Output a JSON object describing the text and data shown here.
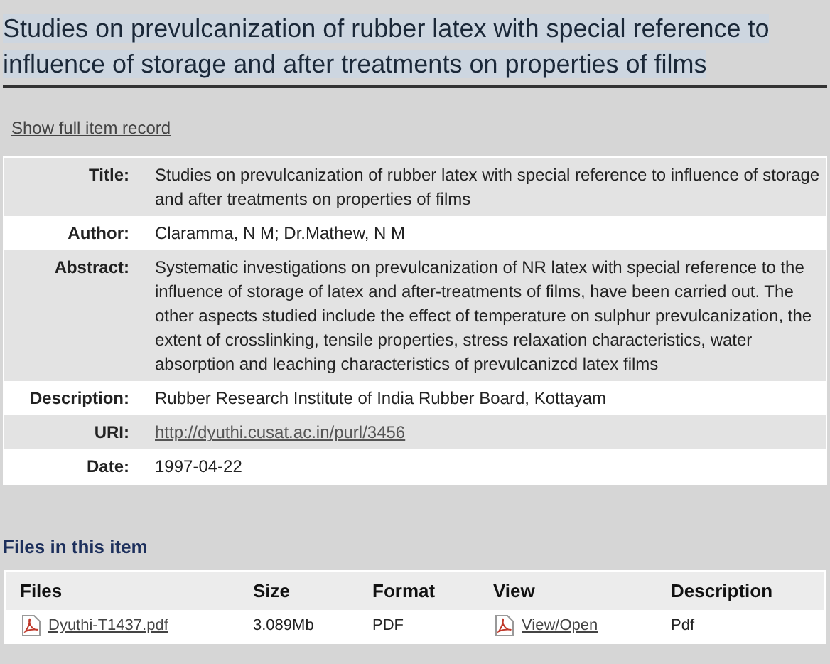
{
  "title": "Studies on prevulcanization of rubber latex with special reference to influence of storage and after treatments on properties of films",
  "full_record_link": "Show full item record",
  "metadata": [
    {
      "label": "Title:",
      "value": "Studies on prevulcanization of rubber latex with special reference to influence of storage and after treatments on properties of films",
      "kind": "text"
    },
    {
      "label": "Author:",
      "value": "Claramma, N M; Dr.Mathew, N M",
      "kind": "text"
    },
    {
      "label": "Abstract:",
      "value": "Systematic investigations on prevulcanization of NR latex with special reference to the influence of storage of latex and after-treatments of films, have been carried out. The other aspects studied include the effect of temperature on sulphur prevulcanization, the extent of crosslinking, tensile properties, stress relaxation characteristics, water absorption and leaching characteristics of prevulcanizcd latex films",
      "kind": "text"
    },
    {
      "label": "Description:",
      "value": "Rubber Research Institute of India Rubber Board, Kottayam",
      "kind": "text"
    },
    {
      "label": "URI:",
      "value": "http://dyuthi.cusat.ac.in/purl/3456",
      "kind": "link"
    },
    {
      "label": "Date:",
      "value": "1997-04-22",
      "kind": "text"
    }
  ],
  "files_heading": "Files in this item",
  "files_table": {
    "columns": [
      "Files",
      "Size",
      "Format",
      "View",
      "Description"
    ],
    "rows": [
      {
        "file": "Dyuthi-T1437.pdf",
        "size": "3.089Mb",
        "format": "PDF",
        "view": "View/Open",
        "description": "Pdf"
      }
    ]
  }
}
